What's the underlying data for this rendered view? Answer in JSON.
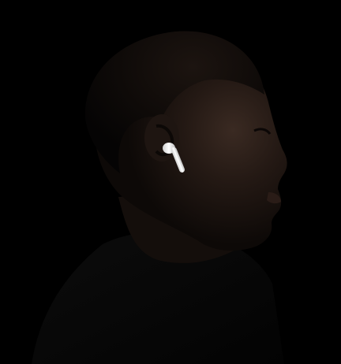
{
  "scene": {
    "subject": "person-profile",
    "facing": "right",
    "accessory": "wireless-earbud",
    "colors": {
      "background": "#000000",
      "skin_shadow": "#0d0907",
      "skin_mid": "#241914",
      "skin_highlight": "#3a2a22",
      "hair": "#0a0706",
      "shirt": "#070707",
      "earbud": "#eeeeee"
    }
  }
}
